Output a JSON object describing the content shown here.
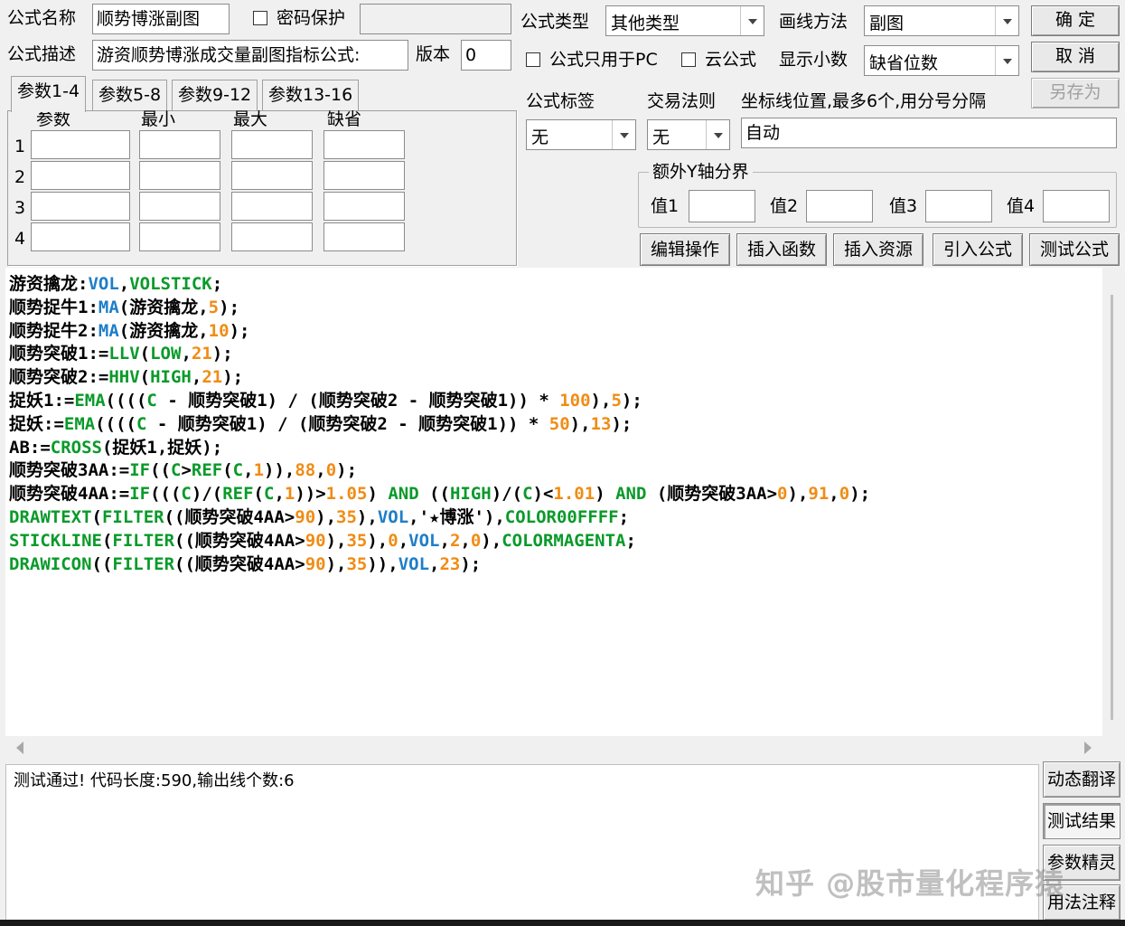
{
  "header": {
    "name_label": "公式名称",
    "name_value": "顺势博涨副图",
    "password_label": "密码保护",
    "password_value": "",
    "desc_label": "公式描述",
    "desc_value": "游资顺势博涨成交量副图指标公式:",
    "version_label": "版本",
    "version_value": "0",
    "type_label": "公式类型",
    "type_value": "其他类型",
    "draw_label": "画线方法",
    "draw_value": "副图",
    "pc_only_label": "公式只用于PC",
    "cloud_label": "云公式",
    "decimal_label": "显示小数",
    "decimal_value": "缺省位数",
    "ok_label": "确  定",
    "cancel_label": "取  消",
    "saveas_label": "另存为"
  },
  "params": {
    "tabs": [
      "参数1-4",
      "参数5-8",
      "参数9-12",
      "参数13-16"
    ],
    "columns": [
      "参数",
      "最小",
      "最大",
      "缺省"
    ],
    "rows": [
      "1",
      "2",
      "3",
      "4"
    ]
  },
  "tag": {
    "tag_label": "公式标签",
    "tag_value": "无",
    "rule_label": "交易法则",
    "rule_value": "无",
    "axis_label": "坐标线位置,最多6个,用分号分隔",
    "axis_value": "自动",
    "extra_label": "额外Y轴分界",
    "values": [
      "值1",
      "值2",
      "值3",
      "值4"
    ]
  },
  "actions": [
    "编辑操作",
    "插入函数",
    "插入资源",
    "引入公式",
    "测试公式"
  ],
  "code": {
    "colors": {
      "k": "#000000",
      "b": "#1e7ec8",
      "g": "#0a9a2a",
      "o": "#f08c14"
    },
    "lines": [
      [
        [
          "游资擒龙:",
          "k"
        ],
        [
          "VOL",
          "b"
        ],
        [
          ",",
          "k"
        ],
        [
          "VOLSTICK",
          "g"
        ],
        [
          ";",
          "k"
        ]
      ],
      [
        [
          "顺势捉牛1:",
          "k"
        ],
        [
          "MA",
          "b"
        ],
        [
          "(游资擒龙,",
          "k"
        ],
        [
          "5",
          "o"
        ],
        [
          ");",
          "k"
        ]
      ],
      [
        [
          "顺势捉牛2:",
          "k"
        ],
        [
          "MA",
          "b"
        ],
        [
          "(游资擒龙,",
          "k"
        ],
        [
          "10",
          "o"
        ],
        [
          ");",
          "k"
        ]
      ],
      [
        [
          "顺势突破1:=",
          "k"
        ],
        [
          "LLV",
          "g"
        ],
        [
          "(",
          "k"
        ],
        [
          "LOW",
          "g"
        ],
        [
          ",",
          "k"
        ],
        [
          "21",
          "o"
        ],
        [
          ");",
          "k"
        ]
      ],
      [
        [
          "顺势突破2:=",
          "k"
        ],
        [
          "HHV",
          "g"
        ],
        [
          "(",
          "k"
        ],
        [
          "HIGH",
          "g"
        ],
        [
          ",",
          "k"
        ],
        [
          "21",
          "o"
        ],
        [
          ");",
          "k"
        ]
      ],
      [
        [
          "捉妖1:=",
          "k"
        ],
        [
          "EMA",
          "g"
        ],
        [
          "((((",
          "k"
        ],
        [
          "C",
          "g"
        ],
        [
          " - 顺势突破1) / (顺势突破2 - 顺势突破1)) * ",
          "k"
        ],
        [
          "100",
          "o"
        ],
        [
          "),",
          "k"
        ],
        [
          "5",
          "o"
        ],
        [
          ");",
          "k"
        ]
      ],
      [
        [
          "捉妖:=",
          "k"
        ],
        [
          "EMA",
          "g"
        ],
        [
          "((((",
          "k"
        ],
        [
          "C",
          "g"
        ],
        [
          " - 顺势突破1) / (顺势突破2 - 顺势突破1)) * ",
          "k"
        ],
        [
          "50",
          "o"
        ],
        [
          "),",
          "k"
        ],
        [
          "13",
          "o"
        ],
        [
          ");",
          "k"
        ]
      ],
      [
        [
          "AB:=",
          "k"
        ],
        [
          "CROSS",
          "g"
        ],
        [
          "(捉妖1,捉妖);",
          "k"
        ]
      ],
      [
        [
          "顺势突破3AA:=",
          "k"
        ],
        [
          "IF",
          "g"
        ],
        [
          "((",
          "k"
        ],
        [
          "C",
          "g"
        ],
        [
          ">",
          "k"
        ],
        [
          "REF",
          "g"
        ],
        [
          "(",
          "k"
        ],
        [
          "C",
          "g"
        ],
        [
          ",",
          "k"
        ],
        [
          "1",
          "o"
        ],
        [
          ")),",
          "k"
        ],
        [
          "88",
          "o"
        ],
        [
          ",",
          "k"
        ],
        [
          "0",
          "o"
        ],
        [
          ");",
          "k"
        ]
      ],
      [
        [
          "顺势突破4AA:=",
          "k"
        ],
        [
          "IF",
          "g"
        ],
        [
          "(((",
          "k"
        ],
        [
          "C",
          "g"
        ],
        [
          ")/(",
          "k"
        ],
        [
          "REF",
          "g"
        ],
        [
          "(",
          "k"
        ],
        [
          "C",
          "g"
        ],
        [
          ",",
          "k"
        ],
        [
          "1",
          "o"
        ],
        [
          "))>",
          "k"
        ],
        [
          "1.05",
          "o"
        ],
        [
          ") ",
          "k"
        ],
        [
          "AND",
          "g"
        ],
        [
          " ((",
          "k"
        ],
        [
          "HIGH",
          "g"
        ],
        [
          ")/(",
          "k"
        ],
        [
          "C",
          "g"
        ],
        [
          ")<",
          "k"
        ],
        [
          "1.01",
          "o"
        ],
        [
          ") ",
          "k"
        ],
        [
          "AND",
          "g"
        ],
        [
          " (顺势突破3AA>",
          "k"
        ],
        [
          "0",
          "o"
        ],
        [
          "),",
          "k"
        ],
        [
          "91",
          "o"
        ],
        [
          ",",
          "k"
        ],
        [
          "0",
          "o"
        ],
        [
          ");",
          "k"
        ]
      ],
      [
        [
          "DRAWTEXT",
          "g"
        ],
        [
          "(",
          "k"
        ],
        [
          "FILTER",
          "g"
        ],
        [
          "((顺势突破4AA>",
          "k"
        ],
        [
          "90",
          "o"
        ],
        [
          "),",
          "k"
        ],
        [
          "35",
          "o"
        ],
        [
          "),",
          "k"
        ],
        [
          "VOL",
          "b"
        ],
        [
          ",'★博涨'),",
          "k"
        ],
        [
          "COLOR00FFFF",
          "g"
        ],
        [
          ";",
          "k"
        ]
      ],
      [
        [
          "STICKLINE",
          "g"
        ],
        [
          "(",
          "k"
        ],
        [
          "FILTER",
          "g"
        ],
        [
          "((顺势突破4AA>",
          "k"
        ],
        [
          "90",
          "o"
        ],
        [
          "),",
          "k"
        ],
        [
          "35",
          "o"
        ],
        [
          "),",
          "k"
        ],
        [
          "0",
          "o"
        ],
        [
          ",",
          "k"
        ],
        [
          "VOL",
          "b"
        ],
        [
          ",",
          "k"
        ],
        [
          "2",
          "o"
        ],
        [
          ",",
          "k"
        ],
        [
          "0",
          "o"
        ],
        [
          "),",
          "k"
        ],
        [
          "COLORMAGENTA",
          "g"
        ],
        [
          ";",
          "k"
        ]
      ],
      [
        [
          "DRAWICON",
          "g"
        ],
        [
          "((",
          "k"
        ],
        [
          "FILTER",
          "g"
        ],
        [
          "((顺势突破4AA>",
          "k"
        ],
        [
          "90",
          "o"
        ],
        [
          "),",
          "k"
        ],
        [
          "35",
          "o"
        ],
        [
          ")),",
          "k"
        ],
        [
          "VOL",
          "b"
        ],
        [
          ",",
          "k"
        ],
        [
          "23",
          "o"
        ],
        [
          ");",
          "k"
        ]
      ]
    ]
  },
  "output": {
    "message": "测试通过! 代码长度:590,输出线个数:6"
  },
  "side_buttons": [
    "动态翻译",
    "测试结果",
    "参数精灵",
    "用法注释"
  ],
  "watermark": "知乎 @股市量化程序猿"
}
